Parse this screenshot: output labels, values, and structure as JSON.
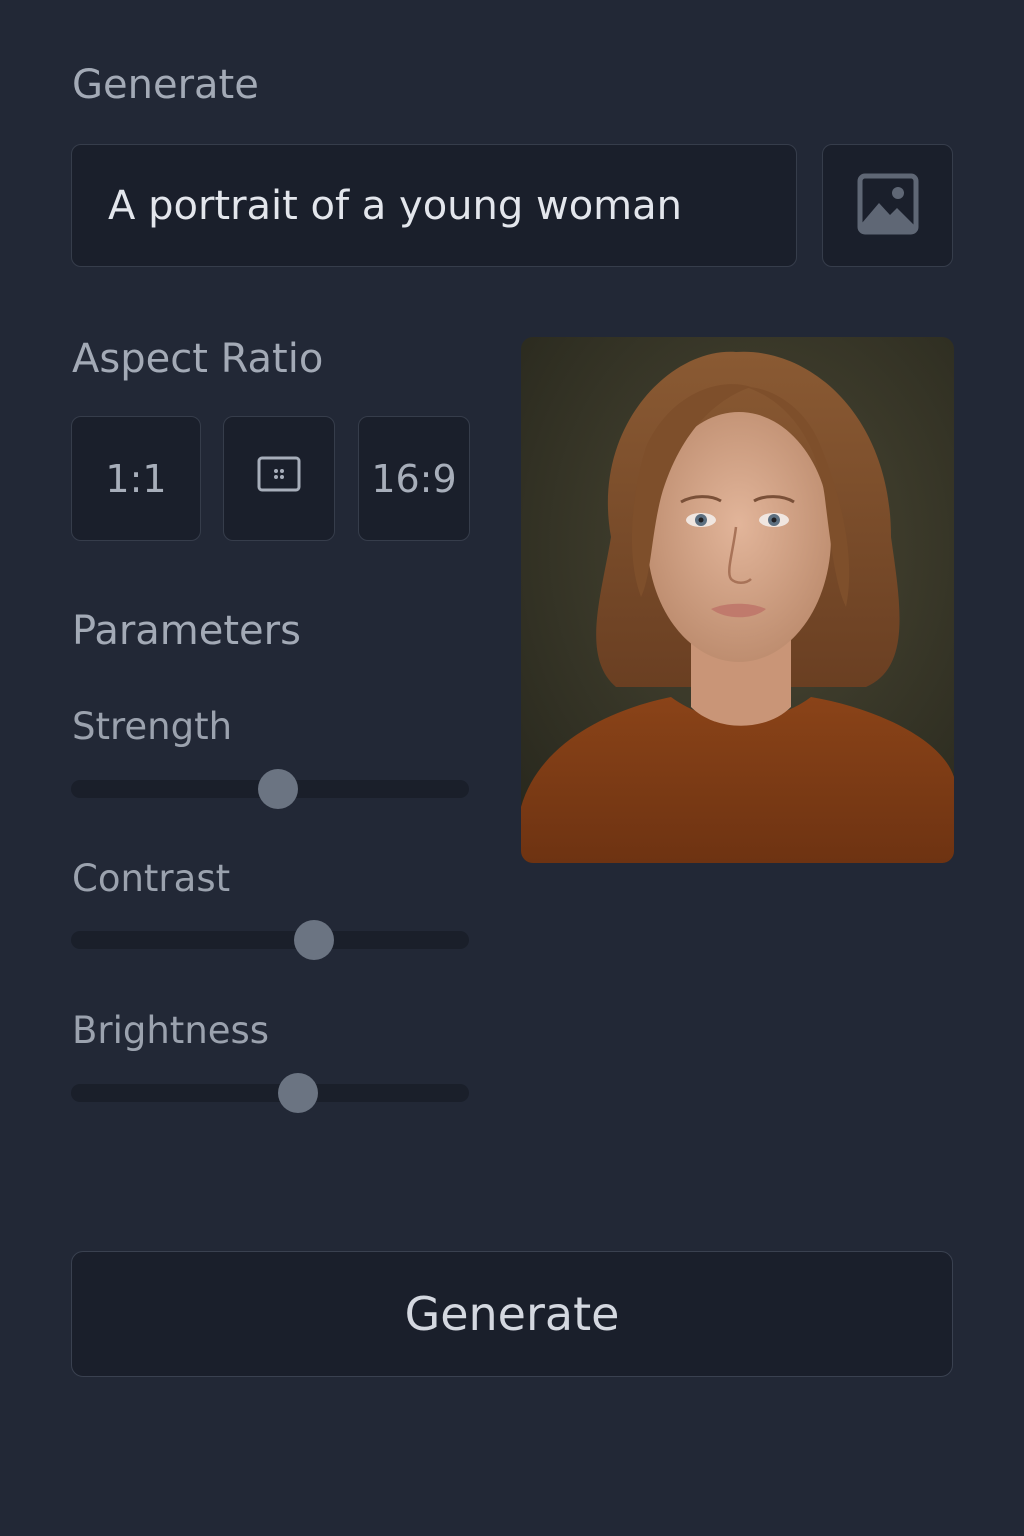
{
  "header": {
    "title": "Generate"
  },
  "prompt": {
    "value": "A portrait of a young woman"
  },
  "image_upload": {
    "icon": "image-icon"
  },
  "aspect_ratio": {
    "title": "Aspect Ratio",
    "options": [
      {
        "label": "1:1"
      },
      {
        "label": "",
        "icon": "aspect-ratio-icon"
      },
      {
        "label": "16:9"
      }
    ]
  },
  "parameters": {
    "title": "Parameters",
    "sliders": [
      {
        "label": "Strength",
        "value": 0.52
      },
      {
        "label": "Contrast",
        "value": 0.61
      },
      {
        "label": "Brightness",
        "value": 0.57
      }
    ]
  },
  "preview": {
    "icon": "portrait-image"
  },
  "generate_button": {
    "label": "Generate"
  },
  "colors": {
    "background": "#222836",
    "panel": "#1a1f2b",
    "border": "#363d4b",
    "thumb": "#6b7482"
  }
}
